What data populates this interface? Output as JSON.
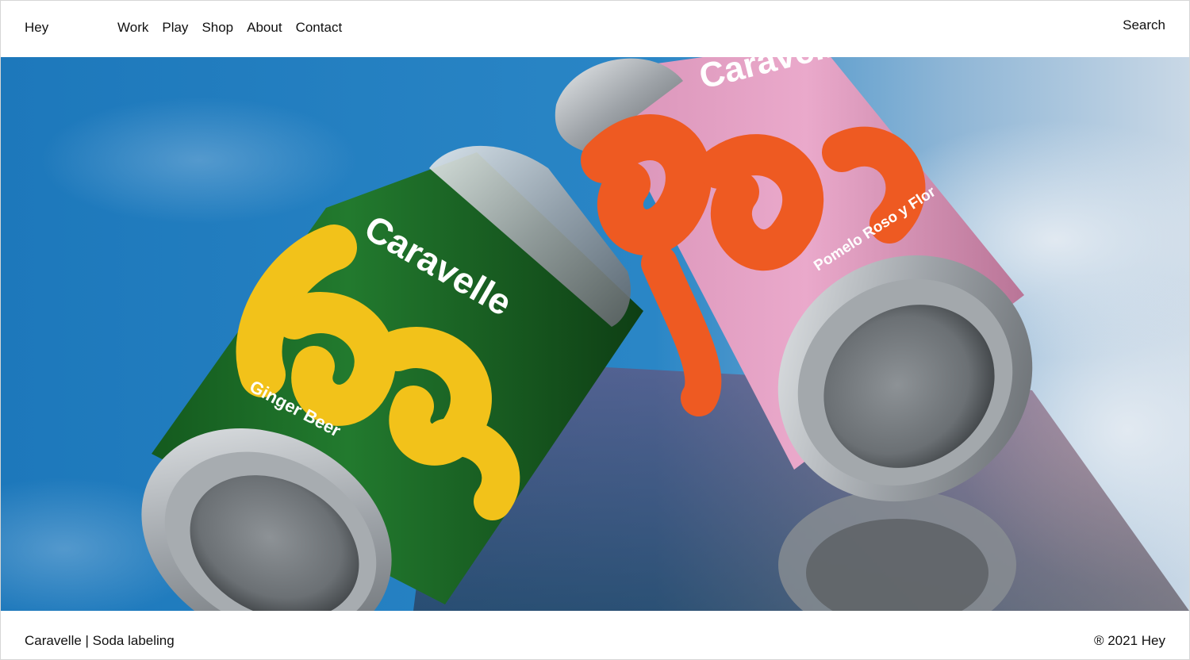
{
  "header": {
    "brand": "Hey",
    "nav": [
      "Work",
      "Play",
      "Shop",
      "About",
      "Contact"
    ],
    "search_label": "Search"
  },
  "hero": {
    "green_can": {
      "brand": "Caravelle",
      "script": "Soda",
      "flavor": "Ginger Beer"
    },
    "pink_can": {
      "brand": "Caravelle",
      "script": "Soda",
      "flavor": "Pomelo Roso y Flor"
    },
    "colors": {
      "sky": "#1f7fc0",
      "green_can": "#1f6e2a",
      "yellow_script": "#f2c21a",
      "pink_can": "#e8a3c6",
      "orange_script": "#ee5a22",
      "metal": "#b9bdc2"
    }
  },
  "footer": {
    "caption": "Caravelle | Soda labeling",
    "copyright": "® 2021 Hey"
  }
}
